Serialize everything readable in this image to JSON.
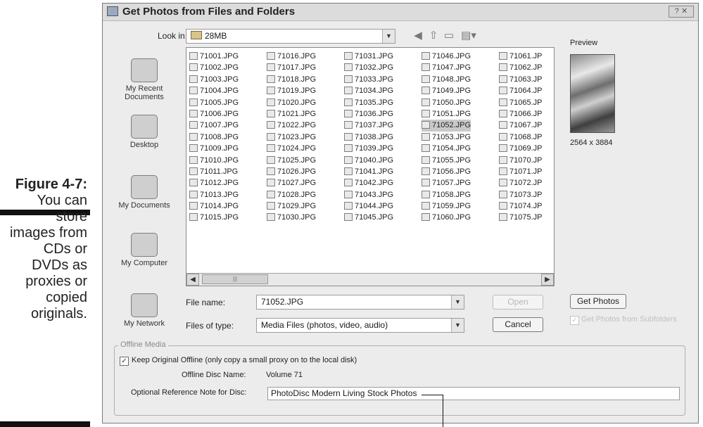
{
  "caption": {
    "figure": "Figure 4-7:",
    "lines": [
      "You can",
      "store",
      "images from",
      "CDs or",
      "DVDs as",
      "proxies or",
      "copied",
      "originals."
    ]
  },
  "dialog": {
    "title": "Get Photos from Files and Folders",
    "look_in_label": "Look in:",
    "look_in_value": "28MB",
    "places": [
      "My Recent Documents",
      "Desktop",
      "My Documents",
      "My Computer",
      "My Network"
    ],
    "file_columns": [
      [
        "71001.JPG",
        "71002.JPG",
        "71003.JPG",
        "71004.JPG",
        "71005.JPG",
        "71006.JPG",
        "71007.JPG",
        "71008.JPG",
        "71009.JPG",
        "71010.JPG",
        "71011.JPG",
        "71012.JPG",
        "71013.JPG",
        "71014.JPG",
        "71015.JPG"
      ],
      [
        "71016.JPG",
        "71017.JPG",
        "71018.JPG",
        "71019.JPG",
        "71020.JPG",
        "71021.JPG",
        "71022.JPG",
        "71023.JPG",
        "71024.JPG",
        "71025.JPG",
        "71026.JPG",
        "71027.JPG",
        "71028.JPG",
        "71029.JPG",
        "71030.JPG"
      ],
      [
        "71031.JPG",
        "71032.JPG",
        "71033.JPG",
        "71034.JPG",
        "71035.JPG",
        "71036.JPG",
        "71037.JPG",
        "71038.JPG",
        "71039.JPG",
        "71040.JPG",
        "71041.JPG",
        "71042.JPG",
        "71043.JPG",
        "71044.JPG",
        "71045.JPG"
      ],
      [
        "71046.JPG",
        "71047.JPG",
        "71048.JPG",
        "71049.JPG",
        "71050.JPG",
        "71051.JPG",
        "71052.JPG",
        "71053.JPG",
        "71054.JPG",
        "71055.JPG",
        "71056.JPG",
        "71057.JPG",
        "71058.JPG",
        "71059.JPG",
        "71060.JPG"
      ],
      [
        "71061.JP",
        "71062.JP",
        "71063.JP",
        "71064.JP",
        "71065.JP",
        "71066.JP",
        "71067.JP",
        "71068.JP",
        "71069.JP",
        "71070.JP",
        "71071.JP",
        "71072.JP",
        "71073.JP",
        "71074.JP",
        "71075.JP"
      ]
    ],
    "selected_file": "71052.JPG",
    "preview_label": "Preview",
    "preview_dimensions": "2564 x 3884",
    "file_name_label": "File name:",
    "file_name_value": "71052.JPG",
    "file_type_label": "Files of type:",
    "file_type_value": "Media Files (photos, video, audio)",
    "open_button": "Open",
    "cancel_button": "Cancel",
    "get_photos_button": "Get Photos",
    "subfolders_label": "Get Photos from Subfolders",
    "offline_group_title": "Offline Media",
    "keep_original_label": "Keep Original Offline (only copy a small proxy on to the local disk)",
    "keep_original_checked": true,
    "disc_name_label": "Offline Disc Name:",
    "disc_name_value": "Volume 71",
    "ref_note_label": "Optional Reference Note for Disc:",
    "ref_note_value": "PhotoDisc Modern Living Stock Photos"
  },
  "icons": {
    "back": "back-icon",
    "up": "up-folder-icon",
    "new_folder": "new-folder-icon",
    "views": "views-menu-icon"
  }
}
